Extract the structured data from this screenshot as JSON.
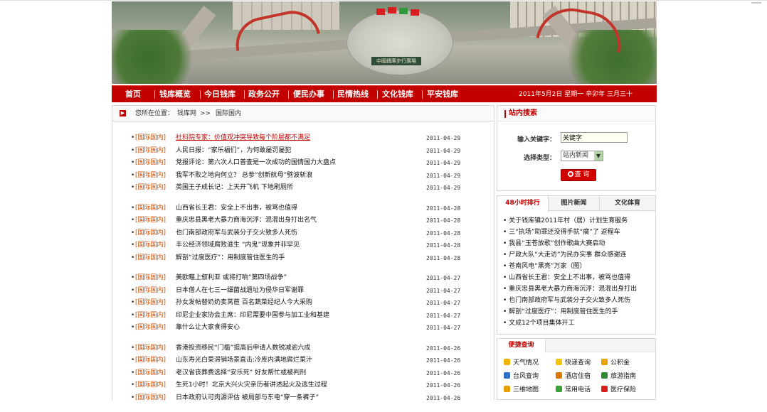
{
  "banner": {
    "sign_text": "中國銭庫步行廣場"
  },
  "nav": {
    "items": [
      {
        "label": "首页"
      },
      {
        "label": "钱库概览"
      },
      {
        "label": "今日钱库"
      },
      {
        "label": "政务公开"
      },
      {
        "label": "便民办事"
      },
      {
        "label": "民情热线"
      },
      {
        "label": "文化钱库"
      },
      {
        "label": "平安钱库"
      }
    ],
    "date": "2011年5月2日 星期一 辛卯年 三月三十"
  },
  "breadcrumb": {
    "prefix": "您所在位置：",
    "site": "钱库网",
    "separator": ">>",
    "current": "国际国内"
  },
  "news": {
    "groups": [
      [
        {
          "cat": "[国际国内]",
          "title": "社科院专家：价值观冲突导致每个阶层都不满足",
          "date": "2011-04-29",
          "hot": true
        },
        {
          "cat": "[国际国内]",
          "title": "人民日报：“家乐福们”，为何敢屡罚屡犯",
          "date": "2011-04-29"
        },
        {
          "cat": "[国际国内]",
          "title": "党报评论：第六次人口普查是一次成功的国情国力大盘点",
          "date": "2011-04-29"
        },
        {
          "cat": "[国际国内]",
          "title": "我军不败之地向何立？ 总参“创新航母”劈波斩浪",
          "date": "2011-04-29"
        },
        {
          "cat": "[国际国内]",
          "title": "英国王子成长记：上天开飞机 下地刷厕所",
          "date": "2011-04-29"
        }
      ],
      [
        {
          "cat": "[国际国内]",
          "title": "山西省长王君：安全上不出事，被骂也值得",
          "date": "2011-04-28"
        },
        {
          "cat": "[国际国内]",
          "title": "重庆忠县黑老大暴力商海沉浮：混混出身打出名气",
          "date": "2011-04-28"
        },
        {
          "cat": "[国际国内]",
          "title": "也门南部政府军与武装分子交火致多人死伤",
          "date": "2011-04-28"
        },
        {
          "cat": "[国际国内]",
          "title": "丰公经济领域腐败滋生 “内鬼”现象并非罕见",
          "date": "2011-04-28"
        },
        {
          "cat": "[国际国内]",
          "title": "解剖“过度医疗”：用制度管住医生的手",
          "date": "2011-04-28"
        }
      ],
      [
        {
          "cat": "[国际国内]",
          "title": "美欧瞄上叙利亚 或将打响“第四场战争”",
          "date": "2011-04-27"
        },
        {
          "cat": "[国际国内]",
          "title": "日本僧人在七三一细菌战遗址为侵华日军谢罪",
          "date": "2011-04-27"
        },
        {
          "cat": "[国际国内]",
          "title": "孙女发帖替奶奶卖莴苣 百名蔬菜经纪人今大采购",
          "date": "2011-04-27"
        },
        {
          "cat": "[国际国内]",
          "title": "印尼企业家协会主席：印尼需要中国参与加工业和基建",
          "date": "2011-04-27"
        },
        {
          "cat": "[国际国内]",
          "title": "靠什么让大家食得安心",
          "date": "2011-04-27"
        }
      ],
      [
        {
          "cat": "[国际国内]",
          "title": "香港投资移民“门槛”提高后申请人数锐减逾六成",
          "date": "2011-04-26"
        },
        {
          "cat": "[国际国内]",
          "title": "山东寿光白菜滞销场景直击:冷库内满地腐烂菜汁",
          "date": "2011-04-26"
        },
        {
          "cat": "[国际国内]",
          "title": "老汉省丧葬费选择“安乐死” 好友帮忙或被判刑",
          "date": "2011-04-26"
        },
        {
          "cat": "[国际国内]",
          "title": "生死1小时！北京大兴火灾亲历者讲述起火及逃生过程",
          "date": "2011-04-26"
        },
        {
          "cat": "[国际国内]",
          "title": "日本政府认可肉源评估 被局部与东电“穿一条裤子”",
          "date": "2011-04-26"
        }
      ]
    ]
  },
  "search": {
    "title": "站内搜索",
    "keyword_label": "输入关键字：",
    "keyword_value": "关键字",
    "type_label": "选择类型：",
    "type_value": "站内新闻",
    "button_label": "查 询"
  },
  "rank": {
    "tabs": [
      {
        "label": "48小时排行",
        "active": true
      },
      {
        "label": "图片新闻"
      },
      {
        "label": "文化体育"
      }
    ],
    "items": [
      "• 关于钱库镇2011年村（居）计划生育服务",
      "• 三“执场”助罪还没得手就“瘸”了 返程车",
      "• 我县“玉苍放歌”创作歌曲大赛启动",
      "• 尸政大队“大走访”为民办实事 群众感谢连",
      "• 苍南风电“黑亮”万家（图）",
      "• 山西省长王君：安全上不出事，被骂也值得",
      "• 重庆忠县黑老大暴力商海沉浮：混混出身打出",
      "• 也门南部政府军与武装分子交火致多人死伤",
      "• 解剖“过度医疗”：用制度管住医生的手",
      "• 文成12个项目集体开工"
    ]
  },
  "quick": {
    "title": "便捷查询",
    "items": [
      {
        "label": "天气情况",
        "icon": "weather-icon",
        "color": "#f0b400"
      },
      {
        "label": "快递查询",
        "icon": "chat-icon",
        "color": "#f3c400"
      },
      {
        "label": "公积金",
        "icon": "house-icon",
        "color": "#e8a300"
      },
      {
        "label": "台风查询",
        "icon": "typhoon-icon",
        "color": "#2f6fc9"
      },
      {
        "label": "酒店住宿",
        "icon": "hotel-icon",
        "color": "#d97a00"
      },
      {
        "label": "旅游指南",
        "icon": "globe-icon",
        "color": "#2f8a2f"
      },
      {
        "label": "三维地图",
        "icon": "map-icon",
        "color": "#e8a000"
      },
      {
        "label": "常用电话",
        "icon": "phone-check-icon",
        "color": "#3aa03a"
      },
      {
        "label": "医疗保险",
        "icon": "medical-cross-icon",
        "color": "#d81b1b"
      }
    ]
  },
  "colors": {
    "brand_red": "#c20000",
    "category_orange": "#d24b00"
  }
}
